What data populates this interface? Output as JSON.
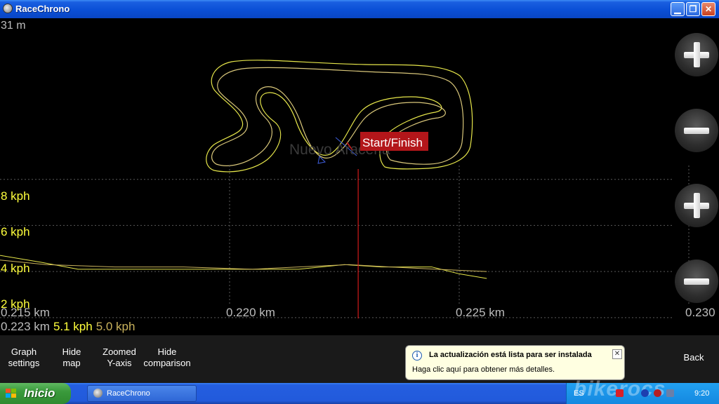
{
  "window": {
    "title": "RaceChrono",
    "icon": "racechrono-app-icon"
  },
  "map": {
    "scale_label": "31 m",
    "track_name": "Nuevo Aracena",
    "marker_label": "Start/Finish",
    "zoom_in_icon": "plus-icon",
    "zoom_out_icon": "minus-icon"
  },
  "graph": {
    "speed_labels": [
      "8 kph",
      "6 kph",
      "4 kph",
      "2 kph"
    ],
    "distance_ticks": [
      "0.215 km",
      "0.220 km",
      "0.225 km",
      "0.230"
    ],
    "readout": {
      "distance": "0.223 km",
      "speed": "5.1 kph",
      "comparison_speed": "5.0 kph"
    },
    "zoom_in_icon": "plus-icon",
    "zoom_out_icon": "minus-icon"
  },
  "chart_data": {
    "type": "line",
    "xlabel": "",
    "ylabel": "",
    "x_unit": "km",
    "y_unit": "kph",
    "xlim": [
      0.215,
      0.23
    ],
    "ylim": [
      1.6,
      8.6
    ],
    "cursor_x": 0.2228,
    "series": [
      {
        "color": "#e6e64a",
        "x": [
          0.215,
          0.2159,
          0.2167,
          0.2185,
          0.22,
          0.2215,
          0.2225,
          0.2233,
          0.2244,
          0.225,
          0.2256
        ],
        "y": [
          4.7,
          4.4,
          4.1,
          4.1,
          4.1,
          4.1,
          4.3,
          4.2,
          4.2,
          3.9,
          3.7
        ]
      },
      {
        "color": "#c9b25c",
        "x": [
          0.215,
          0.216,
          0.2175,
          0.219,
          0.2205,
          0.2215,
          0.2226,
          0.2235,
          0.2245,
          0.2256
        ],
        "y": [
          4.5,
          4.3,
          4.2,
          4.2,
          4.1,
          4.2,
          4.3,
          4.2,
          4.1,
          4.0
        ]
      }
    ]
  },
  "toolbar": {
    "graph_settings": "Graph\nsettings",
    "hide_map": "Hide\nmap",
    "zoomed_y": "Zoomed\nY-axis",
    "hide_comparison": "Hide\ncomparison",
    "back": "Back"
  },
  "notification": {
    "title": "La actualización está lista para ser instalada",
    "body": "Haga clic aquí para obtener más detalles.",
    "icon": "info-icon",
    "close_icon": "close-icon"
  },
  "taskbar": {
    "start_label": "Inicio",
    "task_label": "RaceChrono",
    "tray_language": "ES",
    "clock": "9:20",
    "watermark": "bikerocs"
  },
  "colors": {
    "track_primary": "#e6e64a",
    "track_secondary": "#d9c77a",
    "cursor": "#d11b1b",
    "marker_bg": "#b3161a",
    "speed_label": "#ffff3c",
    "xp_blue": "#0a4fd6",
    "start_green": "#3a9a3c"
  }
}
